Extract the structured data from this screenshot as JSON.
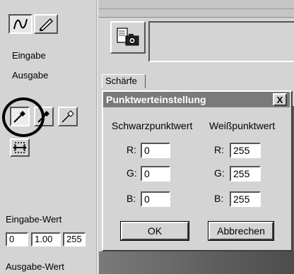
{
  "left": {
    "eingabe_label": "Eingabe",
    "ausgabe_label": "Ausgabe",
    "eingabe_wert_label": "Eingabe-Wert",
    "eingabe_wert_values": [
      "0",
      "1.00",
      "255"
    ],
    "ausgabe_wert_label": "Ausgabe-Wert"
  },
  "tab": {
    "label": "Schärfe"
  },
  "dialog": {
    "title": "Punktwerteinstellung",
    "close_label": "X",
    "black_header": "Schwarzpunktwert",
    "white_header": "Weißpunktwert",
    "black": [
      {
        "channel": "R:",
        "value": "0"
      },
      {
        "channel": "G:",
        "value": "0"
      },
      {
        "channel": "B:",
        "value": "0"
      }
    ],
    "white": [
      {
        "channel": "R:",
        "value": "255"
      },
      {
        "channel": "G:",
        "value": "255"
      },
      {
        "channel": "B:",
        "value": "255"
      }
    ],
    "ok_label": "OK",
    "cancel_label": "Abbrechen"
  },
  "icons": [
    "curve-icon",
    "pencil-icon",
    "eyedropper-icon",
    "camera-icon",
    "flip-icon"
  ]
}
